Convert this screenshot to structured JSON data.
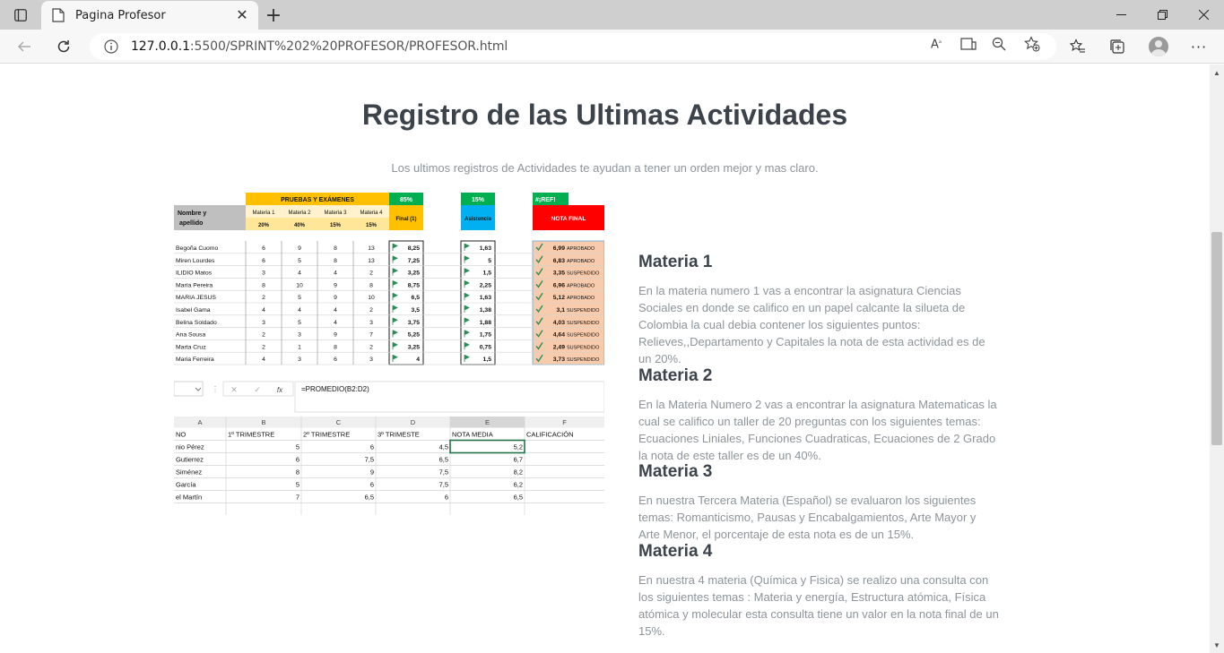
{
  "browser": {
    "tab_title": "Pagina Profesor",
    "url_host": "127.0.0.1",
    "url_path": ":5500/SPRINT%202%20PROFESOR/PROFESOR.html"
  },
  "page": {
    "title": "Registro de las Ultimas Actividades",
    "subtitle": "Los ultimos registros de Actividades te ayudan a tener un orden mejor y mas claro."
  },
  "sheet1": {
    "group_header": "PRUEBAS Y EXÁMENES",
    "pct_final": "85%",
    "pct_asistencia": "15%",
    "ref_error": "#¡REF!",
    "col_nombre": "Nombre y apellido",
    "materias": [
      "Materia 1",
      "Materia 2",
      "Materia 3",
      "Materia 4"
    ],
    "pesos": [
      "20%",
      "40%",
      "15%",
      "15%"
    ],
    "col_final": "Final (1)",
    "col_asistencia": "Asistencia",
    "col_nota": "NOTA FINAL",
    "rows": [
      {
        "nombre": "Begoña Cuomo",
        "m": [
          "6",
          "9",
          "8",
          "13"
        ],
        "final": "8,25",
        "asis": "1,63",
        "nota": "6,99",
        "estado": "APROBADO"
      },
      {
        "nombre": "Miren Lourdes",
        "m": [
          "6",
          "5",
          "8",
          "13"
        ],
        "final": "7,25",
        "asis": "5",
        "nota": "6,83",
        "estado": "APROBADO"
      },
      {
        "nombre": "ILIDIO Matos",
        "m": [
          "3",
          "4",
          "4",
          "2"
        ],
        "final": "3,25",
        "asis": "1,5",
        "nota": "3,35",
        "estado": "SUSPENDIDO"
      },
      {
        "nombre": "María Pereira",
        "m": [
          "8",
          "10",
          "9",
          "8"
        ],
        "final": "8,75",
        "asis": "2,25",
        "nota": "6,96",
        "estado": "APROBADO"
      },
      {
        "nombre": "MARIA JESUS",
        "m": [
          "2",
          "5",
          "9",
          "10"
        ],
        "final": "6,5",
        "asis": "1,63",
        "nota": "5,12",
        "estado": "APROBADO"
      },
      {
        "nombre": "Isabel Gama",
        "m": [
          "4",
          "4",
          "4",
          "2"
        ],
        "final": "3,5",
        "asis": "1,38",
        "nota": "3,1",
        "estado": "SUSPENDIDO"
      },
      {
        "nombre": "Belina Soldado",
        "m": [
          "3",
          "5",
          "4",
          "3"
        ],
        "final": "3,75",
        "asis": "1,88",
        "nota": "4,03",
        "estado": "SUSPENDIDO"
      },
      {
        "nombre": "Ana Sousa",
        "m": [
          "2",
          "3",
          "9",
          "7"
        ],
        "final": "5,25",
        "asis": "1,75",
        "nota": "4,64",
        "estado": "SUSPENDIDO"
      },
      {
        "nombre": "Marta Cruz",
        "m": [
          "2",
          "1",
          "8",
          "2"
        ],
        "final": "3,25",
        "asis": "0,75",
        "nota": "2,49",
        "estado": "SUSPENDIDO"
      },
      {
        "nombre": "Maria Ferreira",
        "m": [
          "4",
          "3",
          "6",
          "3"
        ],
        "final": "4",
        "asis": "1,5",
        "nota": "3,73",
        "estado": "SUSPENDIDO"
      }
    ]
  },
  "sheet2": {
    "formula": "=PROMEDIO(B2:D2)",
    "fx": "fx",
    "col_letters": [
      "A",
      "B",
      "C",
      "D",
      "E",
      "F"
    ],
    "headers": [
      "NO",
      "1º TRIMESTRE",
      "2º TRIMESTRE",
      "3º TRIMESTE",
      "NOTA MEDIA",
      "CALIFICACIÓN"
    ],
    "rows": [
      [
        "nio Pérez",
        "5",
        "6",
        "4,5",
        "5,2",
        ""
      ],
      [
        "Gutierrez",
        "6",
        "7,5",
        "6,5",
        "6,7",
        ""
      ],
      [
        "Siménez",
        "8",
        "9",
        "7,5",
        "8,2",
        ""
      ],
      [
        "García",
        "5",
        "6",
        "7,5",
        "6,2",
        ""
      ],
      [
        "el Martín",
        "7",
        "6,5",
        "6",
        "6,5",
        ""
      ]
    ]
  },
  "materias": [
    {
      "title": "Materia 1",
      "text": "En la materia numero 1 vas a encontrar la asignatura Ciencias Sociales en donde se califico en un papel calcante la silueta de Colombia la cual debia contener los siguientes puntos: Relieves,,Departamento y Capitales la nota de esta actividad es de un 20%."
    },
    {
      "title": "Materia 2",
      "text": "En la Materia Numero 2 vas a encontrar la asignatura Matematicas la cual se califico un taller de 20 preguntas con los siguientes temas: Ecuaciones Liniales, Funciones Cuadraticas, Ecuaciones de 2 Grado la nota de este taller es de un 40%."
    },
    {
      "title": "Materia 3",
      "text": "En nuestra Tercera Materia (Español) se evaluaron los siguientes temas: Romanticismo, Pausas y Encabalgamientos, Arte Mayor y Arte Menor, el porcentaje de esta nota es de un 15%."
    },
    {
      "title": "Materia 4",
      "text": "En nuestra 4 materia (Química y Fisica) se realizo una consulta con los siguientes temas : Materia y energía, Estructura atómica, Física atómica y molecular esta consulta tiene un valor en la nota final de un 15%."
    }
  ],
  "colors": {
    "yellow_header": "#ffc000",
    "green_header": "#00b050",
    "blue_header": "#00b0f0",
    "red_header": "#ff0000",
    "nota_cell": "#f8cbad",
    "heading": "#3d434a",
    "body_text": "#8e949a"
  }
}
